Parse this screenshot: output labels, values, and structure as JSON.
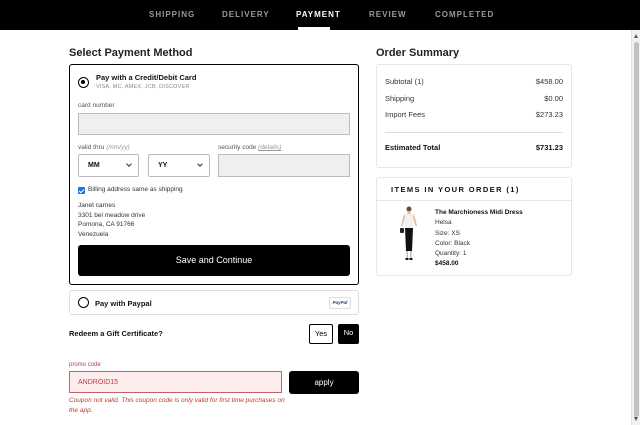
{
  "nav": {
    "steps": [
      "SHIPPING",
      "DELIVERY",
      "PAYMENT",
      "REVIEW",
      "COMPLETED"
    ],
    "active": "PAYMENT"
  },
  "payment": {
    "title": "Select Payment Method",
    "card_option": {
      "label": "Pay with a Credit/Debit Card",
      "accepted": "VISA, MC, AMEX, JCB, DISCOVER",
      "card_number_label": "card number",
      "card_number_value": "",
      "valid_thru_label": "valid thru",
      "valid_thru_hint": "(mm/yy)",
      "month_value": "MM",
      "year_value": "YY",
      "security_label": "security code",
      "security_details": "(details)",
      "security_value": "",
      "billing_same_label": "Billing address same as shipping",
      "billing_same_checked": true,
      "address": [
        "Janet carnes",
        "3301 bel meadow drive",
        "Pomona, CA 91766",
        "Venezuela"
      ],
      "save_button": "Save and Continue"
    },
    "paypal_option": {
      "label": "Pay with Paypal",
      "logo_text": "PayPal"
    },
    "gift": {
      "question": "Redeem a Gift Certificate?",
      "yes": "Yes",
      "no": "No",
      "selected": "No"
    },
    "promo": {
      "label": "promo code",
      "value": "ANDROID15",
      "apply": "apply",
      "error": "Coupon not valid. This coupon code is only valid for first time purchases on the app."
    }
  },
  "summary": {
    "title": "Order Summary",
    "rows": [
      {
        "label": "Subtotal (1)",
        "value": "$458.00"
      },
      {
        "label": "Shipping",
        "value": "$0.00"
      },
      {
        "label": "Import Fees",
        "value": "$273.23"
      }
    ],
    "total_label": "Estimated Total",
    "total_value": "$731.23"
  },
  "items": {
    "title": "ITEMS IN YOUR ORDER (1)",
    "product": {
      "name": "The Marchioness Midi Dress",
      "brand": "Helsa",
      "size": "Size:  XS",
      "color": "Color:  Black",
      "quantity": "Quantity:  1",
      "price": "$458.00"
    }
  },
  "colors": {
    "nav_bg": "#000000",
    "error": "#c0392b",
    "promo_bg": "#fdecec",
    "checkbox": "#1a73e8"
  }
}
